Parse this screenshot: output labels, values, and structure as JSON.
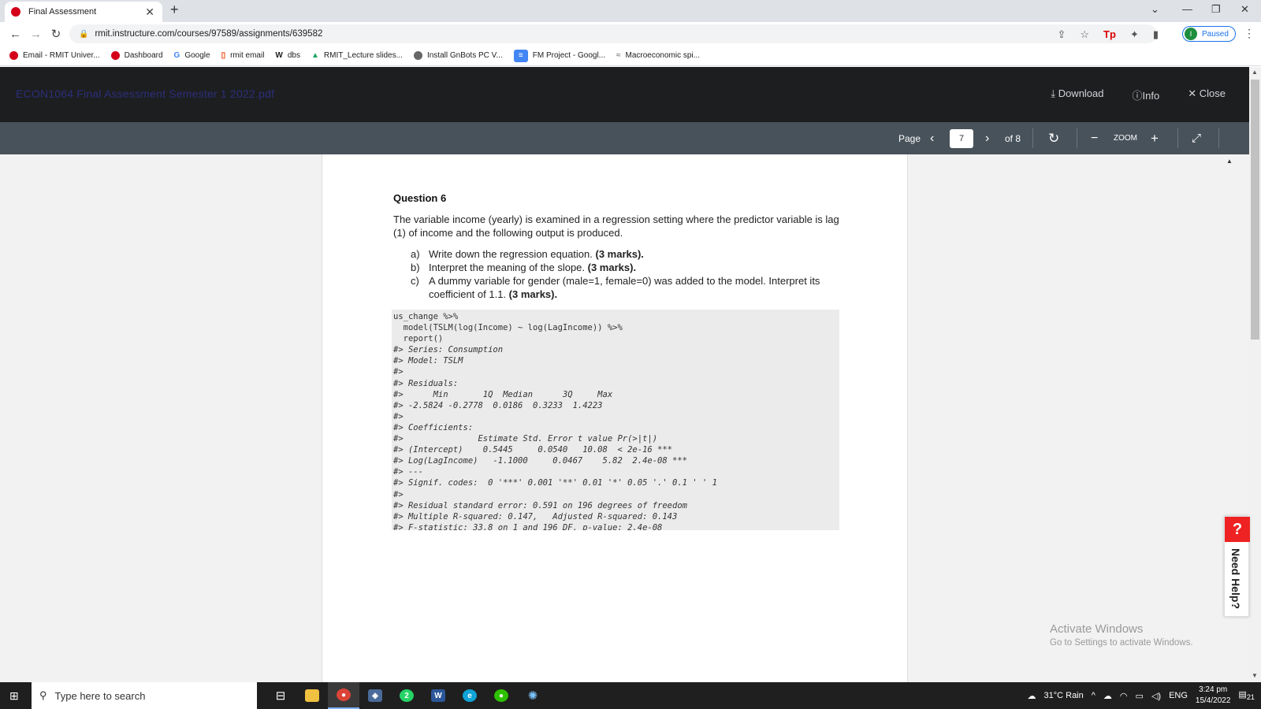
{
  "browser": {
    "tab_title": "Final Assessment",
    "url": "rmit.instructure.com/courses/97589/assignments/639582",
    "profile_initial": "I",
    "profile_status": "Paused",
    "bookmarks": [
      {
        "label": "Email - RMIT Univer...",
        "color": "#d4001a"
      },
      {
        "label": "Dashboard",
        "color": "#d4001a"
      },
      {
        "label": "Google",
        "color": "#4285f4"
      },
      {
        "label": "rmit email",
        "color": "#eb3c00"
      },
      {
        "label": "dbs",
        "color": "#333333"
      },
      {
        "label": "RMIT_Lecture slides...",
        "color": "#1fa463"
      },
      {
        "label": "Install GnBots PC V...",
        "color": "#666666"
      },
      {
        "label": "FM Project - Googl...",
        "color": "#4285f4"
      },
      {
        "label": "Macroeconomic spi...",
        "color": "#555555"
      }
    ]
  },
  "viewer": {
    "title": "ECON1064 Final Assessment Semester 1 2022.pdf",
    "download": "Download",
    "info": "Info",
    "close": "Close",
    "page_label": "Page",
    "page_number": "7",
    "page_of": "of 8",
    "zoom_label": "ZOOM"
  },
  "document": {
    "heading": "Question 6",
    "intro": "The variable income (yearly) is examined in a regression setting where the predictor variable is lag (1) of income and the following output is produced.",
    "items": [
      {
        "label": "a)",
        "text": "Write down the regression equation. ",
        "marks": "(3 marks)."
      },
      {
        "label": "b)",
        "text": "Interpret the meaning of the slope. ",
        "marks": "(3 marks)."
      },
      {
        "label": "c)",
        "text": "A dummy variable for gender (male=1, female=0) was added to the model. Interpret its coefficient of 1.1. ",
        "marks": "(3 marks)."
      }
    ],
    "code_lines": [
      "us_change %>%",
      "  model(TSLM(log(Income) ~ log(LagIncome)) %>%",
      "  report()",
      "#> Series: Consumption",
      "#> Model: TSLM",
      "#>",
      "#> Residuals:",
      "#>      Min       1Q  Median      3Q     Max",
      "#> -2.5824 -0.2778  0.0186  0.3233  1.4223",
      "#>",
      "#> Coefficients:",
      "#>               Estimate Std. Error t value Pr(>|t|)",
      "#> (Intercept)    0.5445     0.0540   10.08  < 2e-16 ***",
      "#> Log(LagIncome)   -1.1000     0.0467    5.82  2.4e-08 ***",
      "#> ---",
      "#> Signif. codes:  0 '***' 0.001 '**' 0.01 '*' 0.05 '.' 0.1 ' ' 1",
      "#>",
      "#> Residual standard error: 0.591 on 196 degrees of freedom",
      "#> Multiple R-squared: 0.147,   Adjusted R-squared: 0.143",
      "#> F-statistic: 33.8 on 1 and 196 DF, p-value: 2.4e-08"
    ]
  },
  "help": {
    "label": "Need Help?",
    "icon": "?"
  },
  "watermark": {
    "line1": "Activate Windows",
    "line2": "Go to Settings to activate Windows."
  },
  "taskbar": {
    "search_placeholder": "Type here to search",
    "weather": "31°C  Rain",
    "language": "ENG",
    "time": "3:24 pm",
    "date": "15/4/2022",
    "notifications": "21",
    "whatsapp_badge": "2"
  }
}
